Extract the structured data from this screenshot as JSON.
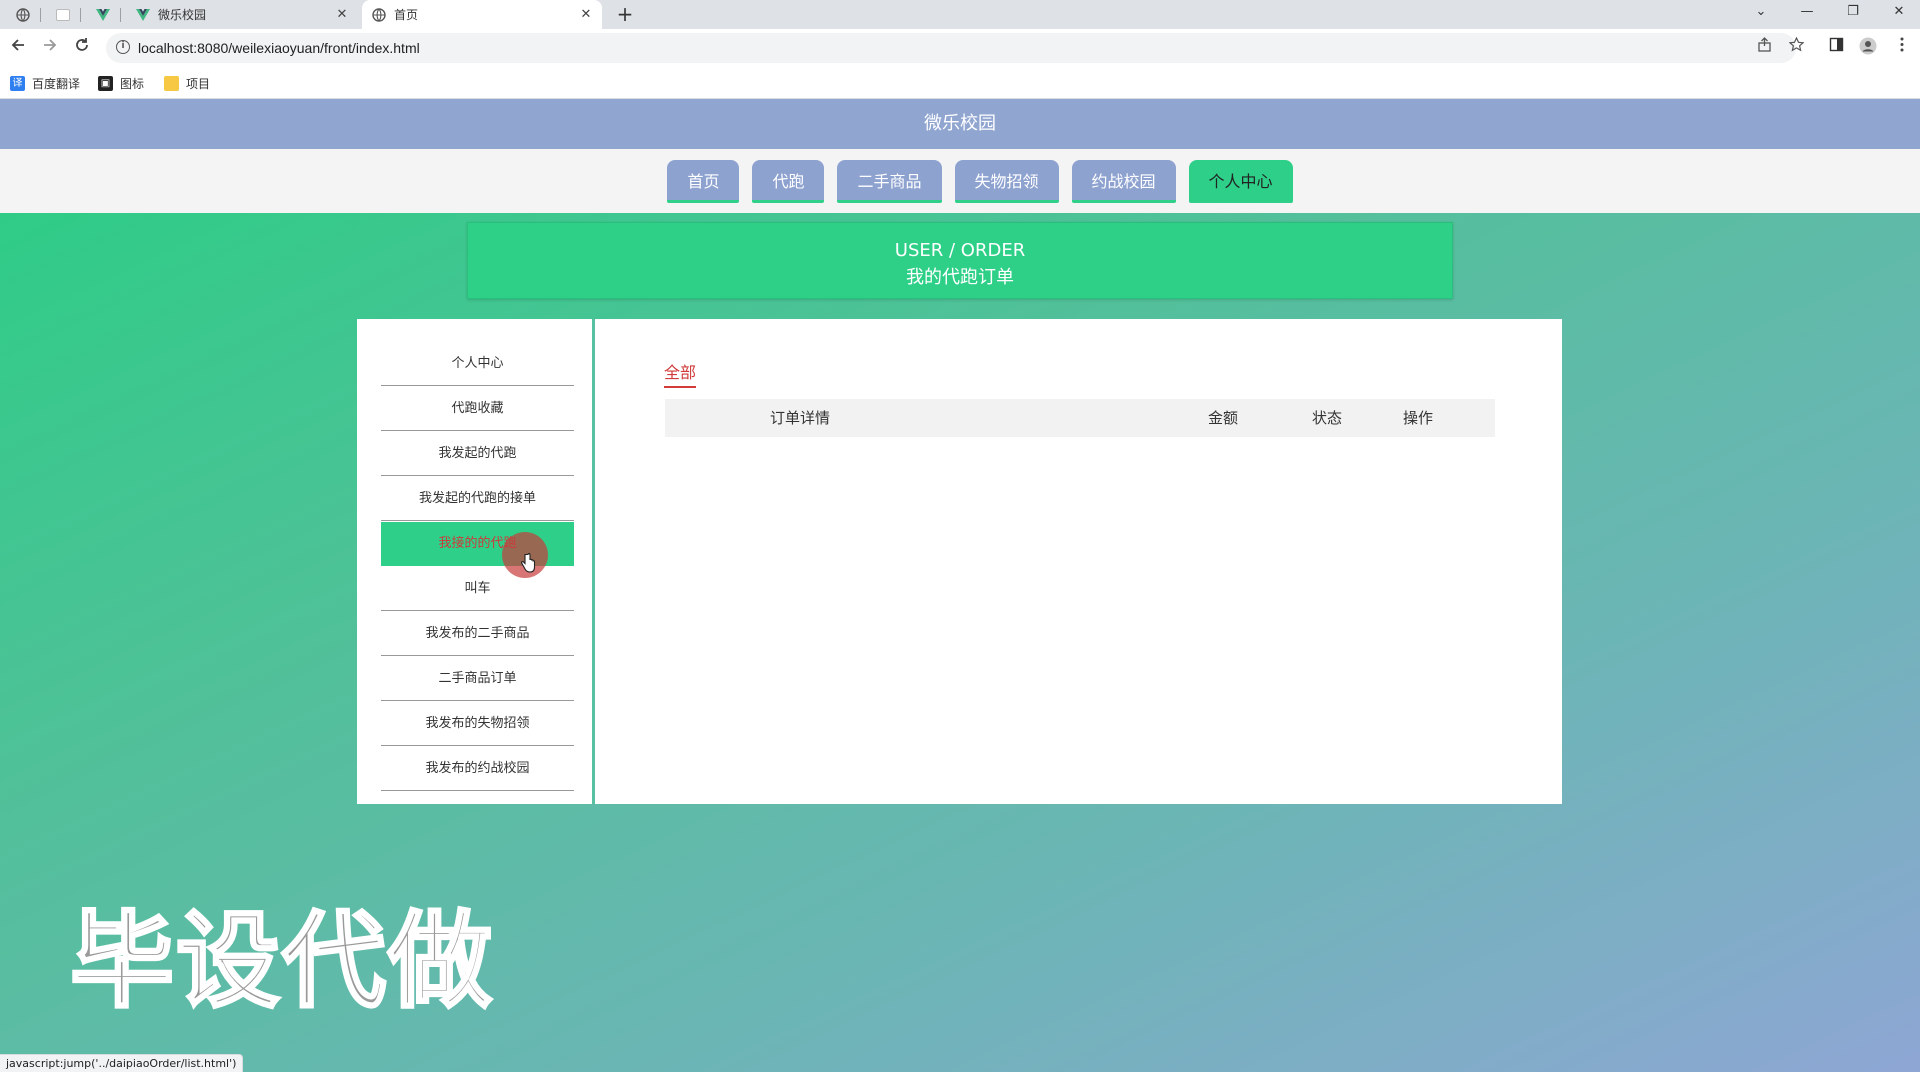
{
  "browser": {
    "tabs": [
      {
        "title": ""
      },
      {
        "title": ""
      },
      {
        "title": ""
      },
      {
        "title": "微乐校园"
      },
      {
        "title": "首页"
      }
    ],
    "tab_close": "✕",
    "new_tab": "+",
    "window_controls": [
      "⌄",
      "—",
      "❐",
      "✕"
    ],
    "url": "localhost:8080/weilexiaoyuan/front/index.html",
    "bookmarks": [
      "百度翻译",
      "图标",
      "项目"
    ],
    "status_url": "javascript:jump('../daipiaoOrder/list.html')"
  },
  "site": {
    "title": "微乐校园",
    "menu": [
      "首页",
      "代跑",
      "二手商品",
      "失物招领",
      "约战校园",
      "个人中心"
    ],
    "active_menu": "个人中心"
  },
  "banner": {
    "en": "USER / ORDER",
    "cn": "我的代跑订单"
  },
  "sidebar": {
    "items": [
      {
        "label": "个人中心"
      },
      {
        "label": "代跑收藏"
      },
      {
        "label": "我发起的代跑"
      },
      {
        "label": "我发起的代跑的接单"
      },
      {
        "label": "我接的的代跑"
      },
      {
        "label": "叫车"
      },
      {
        "label": "我发布的二手商品"
      },
      {
        "label": "二手商品订单"
      },
      {
        "label": "我发布的失物招领"
      },
      {
        "label": "我发布的约战校园"
      }
    ],
    "active_index": 4
  },
  "orders": {
    "filter": "全部",
    "columns": [
      "订单详情",
      "金额",
      "状态",
      "操作"
    ],
    "rows": []
  },
  "watermark": "毕设代做",
  "colors": {
    "header": "#90a5d0",
    "menu_inactive": "#8ea2d0",
    "accent_green": "#2ecf88",
    "active_text": "#cc3b3b"
  }
}
